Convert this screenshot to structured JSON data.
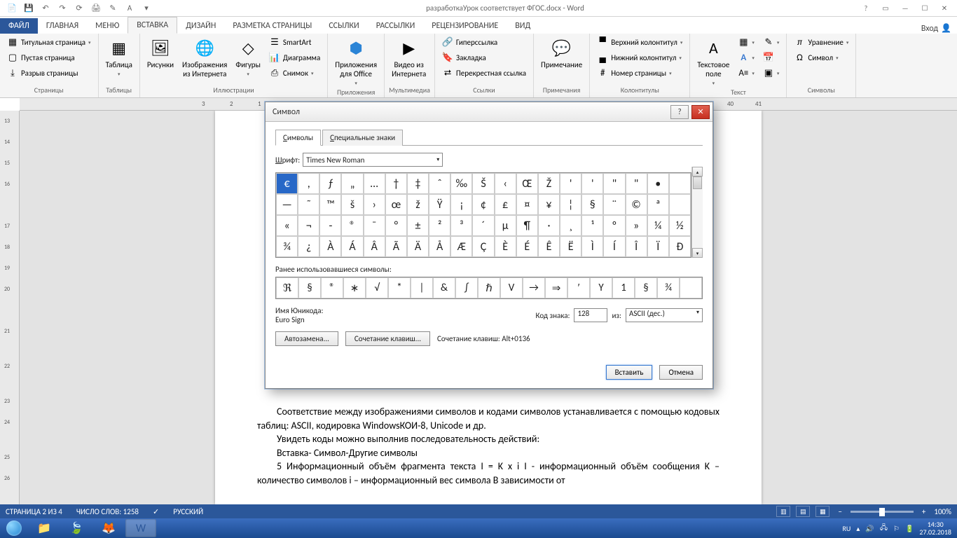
{
  "titlebar": {
    "doc_title": "разработкаУрок соответствует ФГОС.docx - Word"
  },
  "tabs": {
    "file": "ФАЙЛ",
    "home": "ГЛАВНАЯ",
    "menu": "Меню",
    "insert": "ВСТАВКА",
    "design": "ДИЗАЙН",
    "layout": "РАЗМЕТКА СТРАНИЦЫ",
    "references": "ССЫЛКИ",
    "mailings": "РАССЫЛКИ",
    "review": "РЕЦЕНЗИРОВАНИЕ",
    "view": "ВИД",
    "signin": "Вход"
  },
  "ribbon": {
    "pages": {
      "cover": "Титульная страница",
      "blank": "Пустая страница",
      "break": "Разрыв страницы",
      "group": "Страницы"
    },
    "tables": {
      "table": "Таблица",
      "group": "Таблицы"
    },
    "illustrations": {
      "pictures": "Рисунки",
      "online": "Изображения\nиз Интернета",
      "shapes": "Фигуры",
      "smartart": "SmartArt",
      "chart": "Диаграмма",
      "screenshot": "Снимок",
      "group": "Иллюстрации"
    },
    "apps": {
      "apps": "Приложения\nдля Office",
      "group": "Приложения"
    },
    "media": {
      "video": "Видео из\nИнтернета",
      "group": "Мультимедиа"
    },
    "links": {
      "hyperlink": "Гиперссылка",
      "bookmark": "Закладка",
      "crossref": "Перекрестная ссылка",
      "group": "Ссылки"
    },
    "comments": {
      "comment": "Примечание",
      "group": "Примечания"
    },
    "headerfooter": {
      "header": "Верхний колонтитул",
      "footer": "Нижний колонтитул",
      "pagenum": "Номер страницы",
      "group": "Колонтитулы"
    },
    "text": {
      "textbox": "Текстовое\nполе",
      "group": "Текст"
    },
    "symbols": {
      "equation": "Уравнение",
      "symbol": "Символ",
      "group": "Символы"
    }
  },
  "ruler_h": [
    "3",
    "2",
    "1",
    "",
    "1",
    "40",
    "41"
  ],
  "ruler_v": [
    "13",
    "14",
    "15",
    "16",
    "",
    "17",
    "18",
    "19",
    "20",
    "",
    "21",
    "",
    "22",
    "",
    "23",
    "24",
    "",
    "25",
    "26"
  ],
  "dialog": {
    "title": "Символ",
    "tab_symbols": "Символы",
    "tab_symbols_u": "С",
    "tab_special": "Специальные знаки",
    "tab_special_u": "С",
    "font_label": "Шрифт:",
    "font_u": "Ш",
    "font_value": "Times New Roman",
    "symbols": [
      [
        "€",
        ",",
        "ƒ",
        "„",
        "…",
        "†",
        "‡",
        "ˆ",
        "‰",
        "Š",
        "‹",
        "Œ",
        "Ž",
        "'",
        "'",
        "\"",
        "\"",
        "•",
        ""
      ],
      [
        "—",
        "˜",
        "™",
        "š",
        "›",
        "œ",
        "ž",
        "Ÿ",
        "¡",
        "¢",
        "£",
        "¤",
        "¥",
        "¦",
        "§",
        "¨",
        "©",
        "ª",
        ""
      ],
      [
        "«",
        "¬",
        "-",
        "®",
        "¯",
        "°",
        "±",
        "²",
        "³",
        "´",
        "µ",
        "¶",
        "·",
        "¸",
        "¹",
        "º",
        "»",
        "¼",
        "½"
      ],
      [
        "¾",
        "¿",
        "À",
        "Á",
        "Â",
        "Ã",
        "Ä",
        "Å",
        "Æ",
        "Ç",
        "È",
        "É",
        "Ê",
        "Ë",
        "Ì",
        "Í",
        "Î",
        "Ï",
        "Ð"
      ]
    ],
    "recent_label": "Ранее использовавшиеся символы:",
    "recent": [
      "ℜ",
      "§",
      "®",
      "∗",
      "√",
      "*",
      "|",
      "&",
      "∫",
      "ℏ",
      "V",
      "→",
      "⇒",
      "′",
      "Υ",
      "1",
      "§",
      "¾",
      ""
    ],
    "unicode_name_label": "Имя Юникода:",
    "unicode_name": "Euro Sign",
    "code_label": "Код знака:",
    "code_u": "К",
    "code_value": "128",
    "from_label": "из:",
    "from_u": "и",
    "from_value": "ASCII (дес.)",
    "autocorrect": "Автозамена...",
    "autocorrect_u": "А",
    "shortcut": "Сочетание клавиш...",
    "shortcut_text": "Сочетание клавиш: Alt+0136",
    "insert": "Вставить",
    "cancel": "Отмена"
  },
  "document": {
    "p1": "Соответствие между изображениями символов и кодами символов устанавливается с помощью кодовых таблиц: ASCII, кодировка WindowsКОИ-8, Unicode и др.",
    "p2": "Увидеть коды можно выполнив последовательность действий:",
    "p3": "Вставка- Символ-Другие символы",
    "p4": "5 Информационный объём фрагмента текста I = K х i I - информационный объём сообщения K – количество символов i – информационный вес символа В зависимости от"
  },
  "statusbar": {
    "page": "СТРАНИЦА 2 ИЗ 4",
    "words": "ЧИСЛО СЛОВ: 1258",
    "lang": "РУССКИЙ",
    "zoom": "100%"
  },
  "taskbar": {
    "lang": "RU",
    "time": "14:30",
    "date": "27.02.2018"
  }
}
